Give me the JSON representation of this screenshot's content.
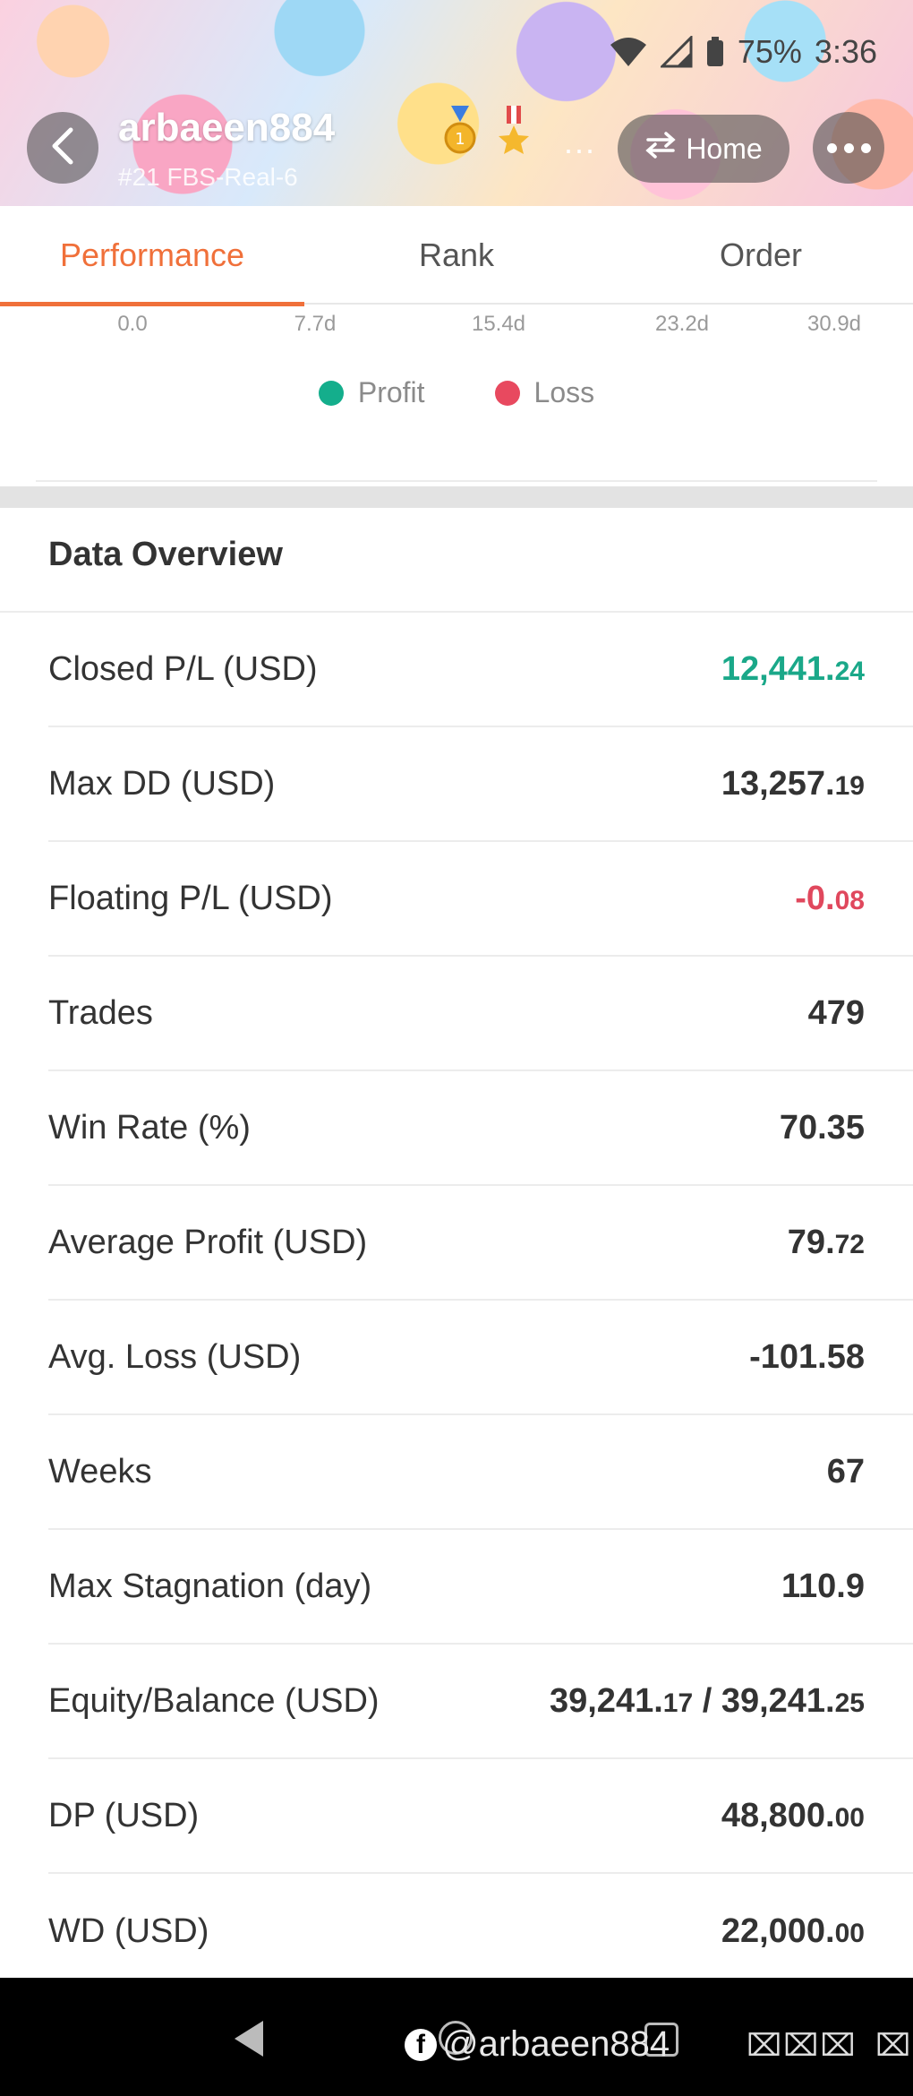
{
  "status_bar": {
    "battery": "75%",
    "time": "3:36"
  },
  "header": {
    "username": "arbaeen884",
    "account": "#21 FBS-Real-6",
    "more_indicator": "...",
    "home_label": "Home"
  },
  "tabs": [
    {
      "label": "Performance",
      "active": true
    },
    {
      "label": "Rank",
      "active": false
    },
    {
      "label": "Order",
      "active": false
    }
  ],
  "chart_axis": {
    "ticks": [
      "0.0",
      "7.7d",
      "15.4d",
      "23.2d",
      "30.9d"
    ]
  },
  "legend": {
    "profit_label": "Profit",
    "loss_label": "Loss",
    "profit_color": "#14ae8c",
    "loss_color": "#e8495f"
  },
  "overview": {
    "title": "Data Overview",
    "rows": [
      {
        "label": "Closed P/L (USD)",
        "int": "12,441.",
        "dec": "24",
        "tone": "pos"
      },
      {
        "label": "Max DD (USD)",
        "int": "13,257.",
        "dec": "19",
        "tone": ""
      },
      {
        "label": "Floating P/L (USD)",
        "int": "-0.",
        "dec": "08",
        "tone": "neg"
      },
      {
        "label": "Trades",
        "int": "479",
        "dec": "",
        "tone": ""
      },
      {
        "label": "Win Rate (%)",
        "int": "70.35",
        "dec": "",
        "tone": ""
      },
      {
        "label": "Average Profit (USD)",
        "int": "79.",
        "dec": "72",
        "tone": ""
      },
      {
        "label": "Avg. Loss (USD)",
        "int": "-101.58",
        "dec": "",
        "tone": ""
      },
      {
        "label": "Weeks",
        "int": "67",
        "dec": "",
        "tone": ""
      },
      {
        "label": "Max Stagnation (day)",
        "int": "110.9",
        "dec": "",
        "tone": ""
      },
      {
        "label": "Equity/Balance (USD)",
        "int": "39,241.",
        "dec": "17",
        "int2": " / 39,241.",
        "dec2": "25",
        "tone": ""
      },
      {
        "label": "DP (USD)",
        "int": "48,800.",
        "dec": "00",
        "tone": ""
      },
      {
        "label": "WD (USD)",
        "int": "22,000.",
        "dec": "00",
        "tone": ""
      }
    ]
  },
  "navbar": {
    "watermark": "@arbaeen884",
    "fb_letter": "f",
    "glyphs": "⌧⌧⌧",
    "glyph_single": "⌧"
  }
}
